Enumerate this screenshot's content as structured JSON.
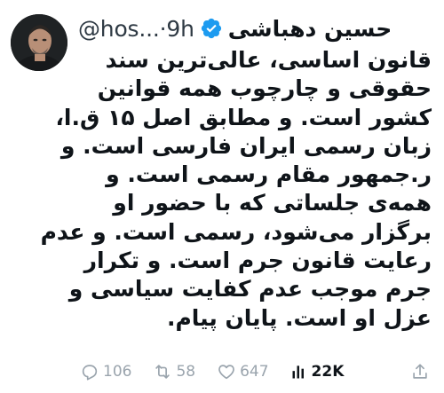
{
  "tweet": {
    "display_name": "حسین دهباشی",
    "handle": "@hos...",
    "separator": "·",
    "time": "9h",
    "verified_icon": "verified-badge-icon",
    "body_lines": [
      "قانون اساسی، عالی‌ترین سند",
      "حقوقی و چارچوب همه قوانین",
      "کشور است. و مطابق اصل ۱۵ ق.ا،",
      "زبان رسمی ایران فارسی است. و",
      "ر.جمهور مقام رسمی است. و",
      "همه‌ی جلساتی که با حضور او",
      "برگزار می‌شود، رسمی است. و عدم",
      "رعایت قانون جرم است. و تکرار",
      "جرم موجب عدم کفایت سیاسی و",
      "عزل او است. پایان پیام."
    ]
  },
  "actions": {
    "replies": "106",
    "retweets": "58",
    "likes": "647",
    "views": "22K"
  },
  "colors": {
    "verified": "#1d9bf0",
    "muted": "#9aa4ad",
    "text": "#0f1419"
  }
}
